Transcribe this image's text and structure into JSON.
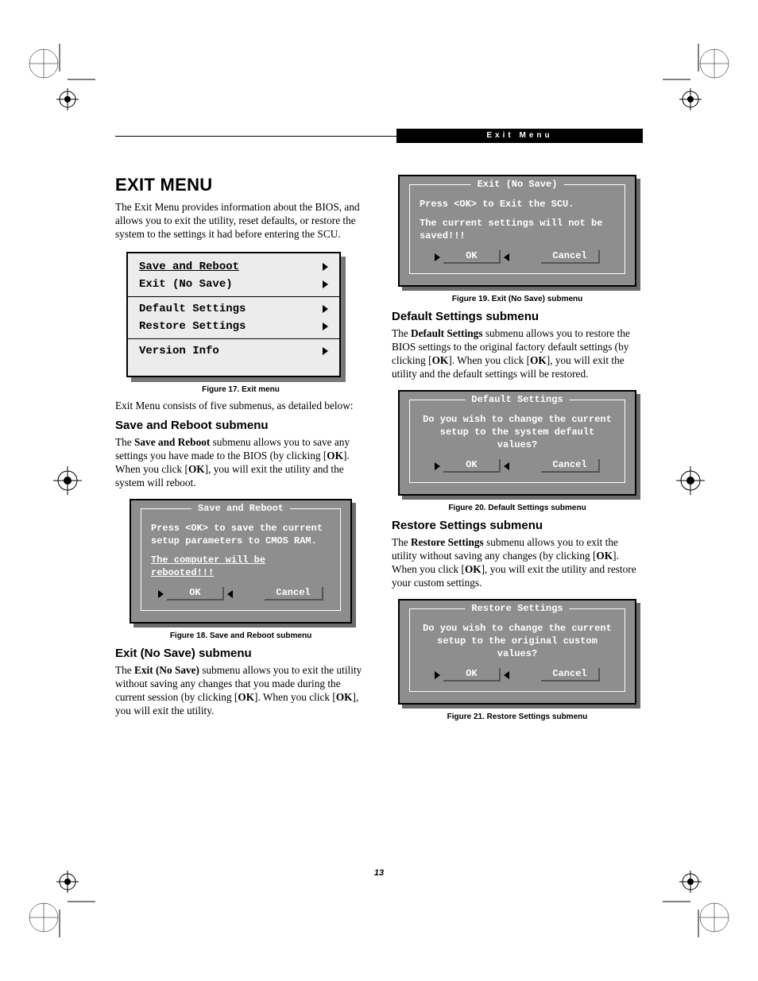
{
  "running_header": "Exit Menu",
  "page_number": "13",
  "h1": "EXIT MENU",
  "intro": "The Exit Menu provides information about the BIOS, and allows you to exit the utility, reset defaults, or restore the system to the settings it had before entering the SCU.",
  "menu": {
    "items": [
      "Save and Reboot",
      "Exit (No Save)",
      "Default Settings",
      "Restore Settings",
      "Version Info"
    ]
  },
  "fig17_caption": "Figure 17.  Exit menu",
  "after_fig17": "Exit Menu consists of five submenus, as detailed below:",
  "save_reboot": {
    "heading": "Save and Reboot submenu",
    "para_pre": "The ",
    "para_bold": "Save and Reboot",
    "para_post": " submenu allows you to save any settings you have made to the BIOS (by clicking [",
    "ok1": "OK",
    "mid": "]. When you click [",
    "ok2": "OK",
    "tail": "], you will exit the utility and the system will reboot.",
    "box": {
      "legend": "Save and Reboot",
      "line1": "Press <OK> to save the current setup parameters to CMOS RAM.",
      "line2": "The computer will be rebooted!!!",
      "ok": "OK",
      "cancel": "Cancel"
    },
    "caption": "Figure 18.  Save and Reboot submenu"
  },
  "exit_nosave": {
    "heading": "Exit (No Save) submenu",
    "para_pre": "The ",
    "para_bold": "Exit (No Save)",
    "para_post": " submenu allows you to exit the utility without saving any changes that you made during the current session (by clicking [",
    "ok1": "OK",
    "mid": "]. When you click [",
    "ok2": "OK",
    "tail": "], you will exit the utility.",
    "box": {
      "legend": "Exit (No Save)",
      "line1": "Press <OK> to Exit the SCU.",
      "line2": "The current settings will not be saved!!!",
      "ok": "OK",
      "cancel": "Cancel"
    },
    "caption": "Figure 19.  Exit (No Save) submenu"
  },
  "default_settings": {
    "heading": "Default Settings submenu",
    "para_pre": "The ",
    "para_bold": "Default Settings",
    "para_post": " submenu allows you to restore the BIOS settings to the original factory default settings (by clicking [",
    "ok1": "OK",
    "mid": "]. When you click [",
    "ok2": "OK",
    "tail": "], you will exit the utility and the default settings will be restored.",
    "box": {
      "legend": "Default Settings",
      "line1": "Do you wish to change the current setup to the system default values?",
      "ok": "OK",
      "cancel": "Cancel"
    },
    "caption": "Figure 20.  Default Settings submenu"
  },
  "restore_settings": {
    "heading": "Restore Settings submenu",
    "para_pre": "The ",
    "para_bold": "Restore Settings",
    "para_post": " submenu allows you to exit the utility without saving any changes (by clicking [",
    "ok1": "OK",
    "mid": "]. When you click [",
    "ok2": "OK",
    "tail": "], you will exit the utility and restore your custom settings.",
    "box": {
      "legend": "Restore Settings",
      "line1": "Do you wish to change the current setup to the original custom values?",
      "ok": "OK",
      "cancel": "Cancel"
    },
    "caption": "Figure 21.  Restore Settings submenu"
  }
}
